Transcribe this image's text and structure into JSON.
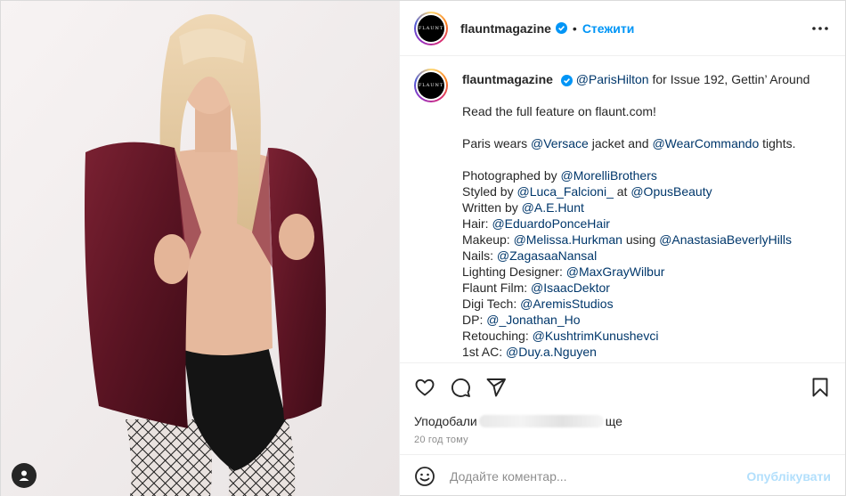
{
  "post": {
    "author": "flauntmagazine",
    "avatar_text": "FLAUNT",
    "follow_label": "Стежити",
    "separator": "•"
  },
  "caption": {
    "username": "flauntmagazine",
    "lines": [
      {
        "parts": [
          {
            "t": "mention",
            "v": "@ParisHilton"
          },
          {
            "t": "text",
            "v": " for Issue 192, Gettin’ Around"
          }
        ]
      },
      {
        "gap": true
      },
      {
        "parts": [
          {
            "t": "text",
            "v": "Read the full feature on flaunt.com!"
          }
        ]
      },
      {
        "gap": true
      },
      {
        "parts": [
          {
            "t": "text",
            "v": "Paris wears "
          },
          {
            "t": "mention",
            "v": "@Versace"
          },
          {
            "t": "text",
            "v": " jacket and "
          },
          {
            "t": "mention",
            "v": "@WearCommando"
          },
          {
            "t": "text",
            "v": " tights."
          }
        ]
      },
      {
        "gap": true
      },
      {
        "parts": [
          {
            "t": "text",
            "v": "Photographed by "
          },
          {
            "t": "mention",
            "v": "@MorelliBrothers"
          }
        ]
      },
      {
        "parts": [
          {
            "t": "text",
            "v": "Styled by "
          },
          {
            "t": "mention",
            "v": "@Luca_Falcioni_"
          },
          {
            "t": "text",
            "v": " at "
          },
          {
            "t": "mention",
            "v": "@OpusBeauty"
          }
        ]
      },
      {
        "parts": [
          {
            "t": "text",
            "v": "Written by "
          },
          {
            "t": "mention",
            "v": "@A.E.Hunt"
          }
        ]
      },
      {
        "parts": [
          {
            "t": "text",
            "v": "Hair: "
          },
          {
            "t": "mention",
            "v": "@EduardoPonceHair"
          }
        ]
      },
      {
        "parts": [
          {
            "t": "text",
            "v": "Makeup: "
          },
          {
            "t": "mention",
            "v": "@Melissa.Hurkman"
          },
          {
            "t": "text",
            "v": " using "
          },
          {
            "t": "mention",
            "v": "@AnastasiaBeverlyHills"
          }
        ]
      },
      {
        "parts": [
          {
            "t": "text",
            "v": "Nails: "
          },
          {
            "t": "mention",
            "v": "@ZagasaaNansal"
          }
        ]
      },
      {
        "parts": [
          {
            "t": "text",
            "v": "Lighting Designer: "
          },
          {
            "t": "mention",
            "v": "@MaxGrayWilbur"
          }
        ]
      },
      {
        "parts": [
          {
            "t": "text",
            "v": "Flaunt Film: "
          },
          {
            "t": "mention",
            "v": "@IsaacDektor"
          }
        ]
      },
      {
        "parts": [
          {
            "t": "text",
            "v": "Digi Tech: "
          },
          {
            "t": "mention",
            "v": "@AremisStudios"
          }
        ]
      },
      {
        "parts": [
          {
            "t": "text",
            "v": "DP: "
          },
          {
            "t": "mention",
            "v": "@_Jonathan_Ho"
          }
        ]
      },
      {
        "parts": [
          {
            "t": "text",
            "v": "Retouching: "
          },
          {
            "t": "mention",
            "v": "@KushtrimKunushevci"
          }
        ]
      },
      {
        "parts": [
          {
            "t": "text",
            "v": "1st AC: "
          },
          {
            "t": "mention",
            "v": "@Duy.a.Nguyen"
          }
        ]
      }
    ]
  },
  "engagement": {
    "likes_prefix": "Уподобали",
    "likes_suffix": "ще",
    "time_ago": "20 год тому"
  },
  "comment": {
    "placeholder": "Додайте коментар...",
    "publish_label": "Опублікувати"
  },
  "icons": {
    "more": "more-horizontal-icon",
    "like": "heart-icon",
    "comment": "comment-bubble-icon",
    "share": "paper-plane-icon",
    "save": "bookmark-icon",
    "emoji": "smiley-icon",
    "tags": "person-icon",
    "verified": "verified-badge-icon"
  },
  "colors": {
    "link": "#00376b",
    "follow": "#0095f6",
    "publish_disabled": "#b2dffc",
    "muted": "#8e8e8e"
  }
}
